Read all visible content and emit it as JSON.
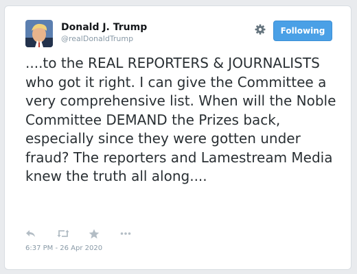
{
  "author": {
    "name": "Donald J. Trump",
    "handle": "@realDonaldTrump"
  },
  "follow_button": {
    "label": "Following"
  },
  "tweet": {
    "text": "....to the REAL REPORTERS & JOURNALISTS who got it right. I can give the Committee a very comprehensive list. When will the Noble Committee DEMAND the Prizes back, especially since they were gotten under fraud? The reporters and Lamestream Media knew the truth all along....",
    "timestamp": "6:37 PM - 26 Apr 2020"
  },
  "actions": [
    "reply-icon",
    "retweet-icon",
    "favorite-icon",
    "more-icon"
  ],
  "colors": {
    "accent": "#4aa0e6",
    "text": "#292f33",
    "muted": "#8899a6",
    "icon": "#b3bdc5"
  }
}
